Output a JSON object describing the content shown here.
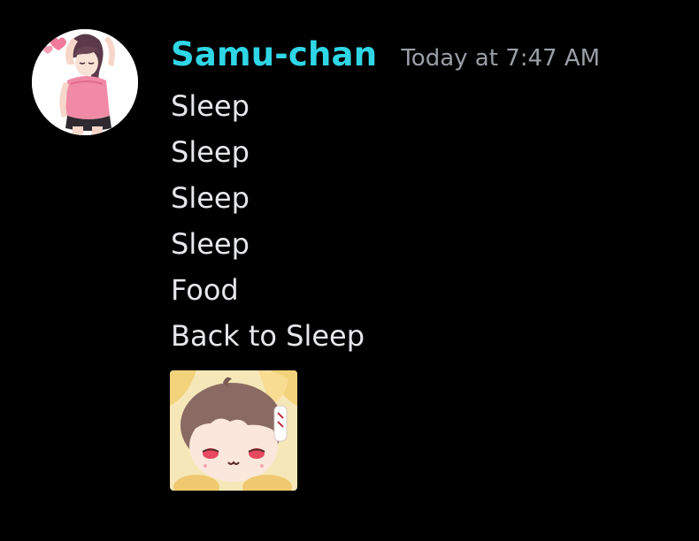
{
  "message": {
    "author": {
      "name": "Samu-chan",
      "name_color": "#2fd6e6",
      "avatar_icon": "anime-girl-avatar"
    },
    "timestamp": "Today at 7:47 AM",
    "lines": [
      "Sleep",
      "Sleep",
      "Sleep",
      "Sleep",
      "Food",
      "Back to Sleep"
    ],
    "sticker_icon": "sleepy-anime-girl-sticker"
  }
}
